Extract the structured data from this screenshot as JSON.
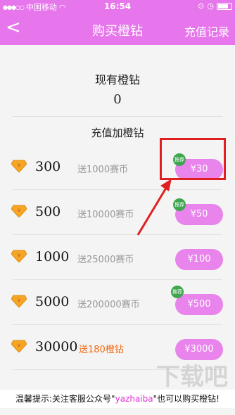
{
  "status_bar": {
    "carrier": "中国移动",
    "time": "16:54"
  },
  "nav": {
    "back_label": "<",
    "title": "购买橙钻",
    "record_label": "充值记录"
  },
  "balance": {
    "label": "现有橙钻",
    "value": "0"
  },
  "section_title": "充值加橙钻",
  "packages": [
    {
      "amount": "300",
      "bonus": "送1000赛币",
      "price": "¥30",
      "recommended": true,
      "badge": "推荐"
    },
    {
      "amount": "500",
      "bonus": "送10000赛币",
      "price": "¥50",
      "recommended": true,
      "badge": "推荐"
    },
    {
      "amount": "1000",
      "bonus": "送25000赛币",
      "price": "¥100",
      "recommended": false,
      "badge": ""
    },
    {
      "amount": "5000",
      "bonus": "送200000赛币",
      "price": "¥500",
      "recommended": true,
      "badge": "推荐"
    },
    {
      "amount": "30000",
      "bonus": "送180橙钻",
      "price": "¥3000",
      "recommended": false,
      "badge": ""
    }
  ],
  "tip": {
    "prefix": "温馨提示:关注客服公众号\"",
    "account": "yazhaiba",
    "suffix": "\"也可以购买橙钻!"
  },
  "colors": {
    "brand": "#e776ec",
    "button": "#e884ec",
    "highlight": "#e02020",
    "bonus_orange": "#f06a12"
  }
}
